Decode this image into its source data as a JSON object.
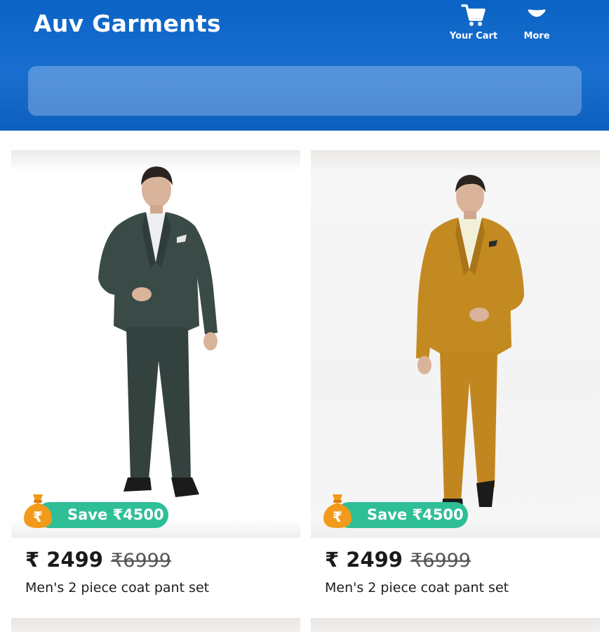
{
  "header": {
    "title": "Auv Garments",
    "cart_label": "Your Cart",
    "more_label": "More",
    "search_placeholder": ""
  },
  "colors": {
    "header_blue": "#0a63c4",
    "save_badge": "#2fbf96",
    "bag_orange": "#f29a1b"
  },
  "icons": {
    "cart": "shopping-cart-icon",
    "more": "chevron-down-icon",
    "bag": "money-bag-icon"
  },
  "products": [
    {
      "save_text": "Save ₹4500",
      "bag_symbol": "₹",
      "price": "₹ 2499",
      "mrp": "₹6999",
      "title": "Men's 2 piece coat pant set",
      "suit_color": "#3a4a47"
    },
    {
      "save_text": "Save ₹4500",
      "bag_symbol": "₹",
      "price": "₹ 2499",
      "mrp": "₹6999",
      "title": "Men's 2 piece coat pant set",
      "suit_color": "#c48a22"
    }
  ]
}
